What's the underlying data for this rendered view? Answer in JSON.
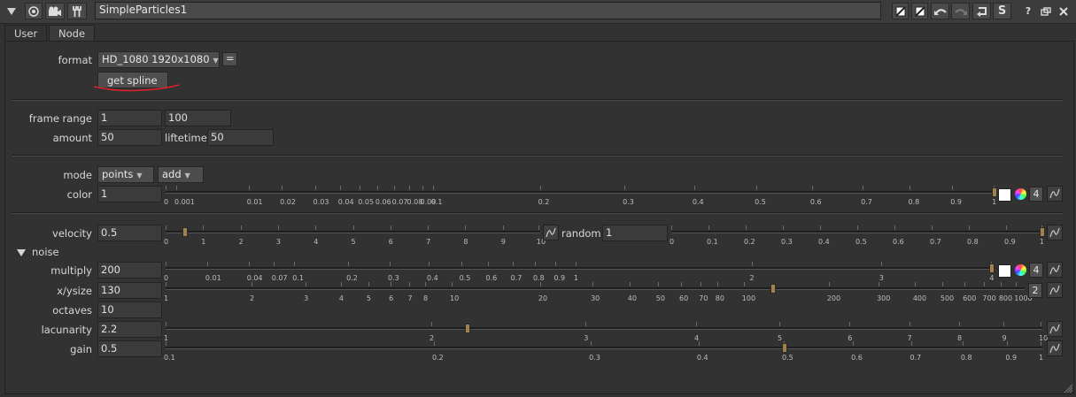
{
  "title_bar": {
    "node_name": "SimpleParticles1",
    "icons": [
      "collapse-triangle-icon",
      "viewer-icon",
      "camera-icon",
      "wrench-icon",
      "pin-white-icon",
      "pin-white-icon",
      "undo-icon",
      "redo-icon",
      "revert-icon",
      "simple-s-icon",
      "help-icon",
      "float-icon",
      "close-icon"
    ],
    "help_label": "?",
    "s_label": "S"
  },
  "tabs": [
    {
      "label": "User",
      "active": true
    },
    {
      "label": "Node",
      "active": false
    }
  ],
  "format": {
    "label": "format",
    "value": "HD_1080 1920x1080",
    "eq_label": "="
  },
  "get_spline_label": "get spline",
  "frame_range": {
    "label": "frame range",
    "start": "1",
    "end": "100"
  },
  "amount": {
    "label": "amount",
    "value": "50"
  },
  "lifetime": {
    "label": "liftetime",
    "value": "50"
  },
  "mode": {
    "label": "mode",
    "value1": "points",
    "value2": "add"
  },
  "color": {
    "label": "color",
    "value": "1",
    "slider_value": 1,
    "ticks": [
      "0",
      "0.001",
      "0.01",
      "0.02",
      "0.03",
      "0.04",
      "0.05",
      "0.06",
      "0.07",
      "0.08",
      "0.09",
      "0.1",
      "0.2",
      "0.3",
      "0.4",
      "0.5",
      "0.6",
      "0.7",
      "0.8",
      "0.9",
      "1"
    ],
    "channels": "4"
  },
  "velocity": {
    "label": "velocity",
    "value": "0.5",
    "slider_value": 0.5,
    "ticks": [
      "0",
      "1",
      "2",
      "3",
      "4",
      "5",
      "6",
      "7",
      "8",
      "9",
      "10"
    ]
  },
  "random": {
    "label": "random",
    "value": "1",
    "slider_value": 1,
    "ticks": [
      "0",
      "0.1",
      "0.2",
      "0.3",
      "0.4",
      "0.5",
      "0.6",
      "0.7",
      "0.8",
      "0.9",
      "1"
    ]
  },
  "noise": {
    "label": "noise"
  },
  "multiply": {
    "label": "multiply",
    "value": "200",
    "slider_value": 200,
    "ticks": [
      "0",
      "0.01",
      "0.04",
      "0.07",
      "0.1",
      "0.2",
      "0.3",
      "0.4",
      "0.5",
      "0.6",
      "0.7",
      "0.8",
      "0.9",
      "1",
      "2",
      "3",
      "4"
    ],
    "channels": "4"
  },
  "xysize": {
    "label": "x/ysize",
    "value": "130",
    "slider_value": 130,
    "ticks": [
      "1",
      "2",
      "3",
      "4",
      "5",
      "6",
      "7",
      "8",
      "10",
      "20",
      "30",
      "40",
      "50",
      "60",
      "70",
      "80",
      "100",
      "200",
      "300",
      "400",
      "500",
      "600",
      "700",
      "800",
      "1000"
    ],
    "channels": "2"
  },
  "octaves": {
    "label": "octaves",
    "value": "10"
  },
  "lacunarity": {
    "label": "lacunarity",
    "value": "2.2",
    "slider_value": 2.2,
    "ticks": [
      "1",
      "2",
      "3",
      "4",
      "5",
      "6",
      "7",
      "8",
      "9",
      "10"
    ]
  },
  "gain": {
    "label": "gain",
    "value": "0.5",
    "slider_value": 0.5,
    "ticks": [
      "0.1",
      "0.2",
      "0.3",
      "0.4",
      "0.5",
      "0.6",
      "0.7",
      "0.8",
      "0.9",
      "1"
    ]
  },
  "colors": {
    "handle": "#a0834a",
    "annotation_red": "#e0202a",
    "panel_bg": "#323232"
  }
}
